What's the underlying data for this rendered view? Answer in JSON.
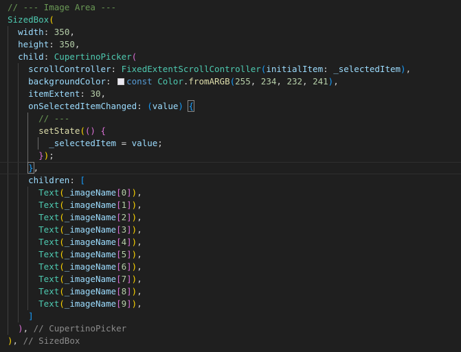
{
  "colors": {
    "background": "#1f1f1f",
    "comment": "#6a9955",
    "class": "#4ec9b0",
    "property": "#9cdcfe",
    "number": "#b5cea8",
    "keyword": "#569cd6",
    "function": "#dcdcaa",
    "bracket_level1": "#ffd700",
    "bracket_level2": "#da70d6",
    "bracket_level3": "#179fff",
    "swatch": "#eae8f1"
  },
  "lines": [
    [
      {
        "t": "// --- Image Area ---",
        "c": "comment"
      }
    ],
    [
      {
        "t": "SizedBox",
        "c": "class"
      },
      {
        "t": "(",
        "c": "p1"
      }
    ],
    [
      {
        "t": "  "
      },
      {
        "t": "width",
        "c": "prop"
      },
      {
        "t": ": "
      },
      {
        "t": "350",
        "c": "num"
      },
      {
        "t": ","
      }
    ],
    [
      {
        "t": "  "
      },
      {
        "t": "height",
        "c": "prop"
      },
      {
        "t": ": "
      },
      {
        "t": "350",
        "c": "num"
      },
      {
        "t": ","
      }
    ],
    [
      {
        "t": "  "
      },
      {
        "t": "child",
        "c": "prop"
      },
      {
        "t": ": "
      },
      {
        "t": "CupertinoPicker",
        "c": "class"
      },
      {
        "t": "(",
        "c": "p2"
      }
    ],
    [
      {
        "t": "    "
      },
      {
        "t": "scrollController",
        "c": "prop"
      },
      {
        "t": ": "
      },
      {
        "t": "FixedExtentScrollController",
        "c": "class"
      },
      {
        "t": "(",
        "c": "p3"
      },
      {
        "t": "initialItem",
        "c": "prop"
      },
      {
        "t": ": "
      },
      {
        "t": "_selectedItem",
        "c": "prop"
      },
      {
        "t": ")",
        "c": "p3"
      },
      {
        "t": ","
      }
    ],
    [
      {
        "t": "    "
      },
      {
        "t": "backgroundColor",
        "c": "prop"
      },
      {
        "t": ": "
      },
      {
        "swatch": true
      },
      {
        "t": "const",
        "c": "kw"
      },
      {
        "t": " "
      },
      {
        "t": "Color",
        "c": "class"
      },
      {
        "t": "."
      },
      {
        "t": "fromARGB",
        "c": "fn"
      },
      {
        "t": "(",
        "c": "p3"
      },
      {
        "t": "255",
        "c": "num"
      },
      {
        "t": ", "
      },
      {
        "t": "234",
        "c": "num"
      },
      {
        "t": ", "
      },
      {
        "t": "232",
        "c": "num"
      },
      {
        "t": ", "
      },
      {
        "t": "241",
        "c": "num"
      },
      {
        "t": ")",
        "c": "p3"
      },
      {
        "t": ","
      }
    ],
    [
      {
        "t": "    "
      },
      {
        "t": "itemExtent",
        "c": "prop"
      },
      {
        "t": ": "
      },
      {
        "t": "30",
        "c": "num"
      },
      {
        "t": ","
      }
    ],
    [
      {
        "t": "    "
      },
      {
        "t": "onSelectedItemChanged",
        "c": "prop"
      },
      {
        "t": ": "
      },
      {
        "t": "(",
        "c": "p3"
      },
      {
        "t": "value",
        "c": "prop"
      },
      {
        "t": ")",
        "c": "p3"
      },
      {
        "t": " "
      },
      {
        "t": "{",
        "c": "p3",
        "box": true
      }
    ],
    [
      {
        "t": "      "
      },
      {
        "t": "// ---",
        "c": "comment"
      }
    ],
    [
      {
        "t": "      "
      },
      {
        "t": "setState",
        "c": "fn"
      },
      {
        "t": "(",
        "c": "p1"
      },
      {
        "t": "()",
        "c": "p2"
      },
      {
        "t": " "
      },
      {
        "t": "{",
        "c": "p2"
      }
    ],
    [
      {
        "t": "        "
      },
      {
        "t": "_selectedItem",
        "c": "prop"
      },
      {
        "t": " = "
      },
      {
        "t": "value",
        "c": "prop"
      },
      {
        "t": ";"
      }
    ],
    [
      {
        "t": "      "
      },
      {
        "t": "}",
        "c": "p2"
      },
      {
        "t": ")",
        "c": "p1"
      },
      {
        "t": ";"
      }
    ],
    [
      {
        "t": "    "
      },
      {
        "t": "}",
        "c": "p3",
        "box": true
      },
      {
        "t": ","
      }
    ],
    [
      {
        "t": "    "
      },
      {
        "t": "children",
        "c": "prop"
      },
      {
        "t": ": "
      },
      {
        "t": "[",
        "c": "p3"
      }
    ],
    [
      {
        "t": "      "
      },
      {
        "t": "Text",
        "c": "class"
      },
      {
        "t": "(",
        "c": "p1"
      },
      {
        "t": "_imageName",
        "c": "prop"
      },
      {
        "t": "[",
        "c": "p2"
      },
      {
        "t": "0",
        "c": "num"
      },
      {
        "t": "]",
        "c": "p2"
      },
      {
        "t": ")",
        "c": "p1"
      },
      {
        "t": ","
      }
    ],
    [
      {
        "t": "      "
      },
      {
        "t": "Text",
        "c": "class"
      },
      {
        "t": "(",
        "c": "p1"
      },
      {
        "t": "_imageName",
        "c": "prop"
      },
      {
        "t": "[",
        "c": "p2"
      },
      {
        "t": "1",
        "c": "num"
      },
      {
        "t": "]",
        "c": "p2"
      },
      {
        "t": ")",
        "c": "p1"
      },
      {
        "t": ","
      }
    ],
    [
      {
        "t": "      "
      },
      {
        "t": "Text",
        "c": "class"
      },
      {
        "t": "(",
        "c": "p1"
      },
      {
        "t": "_imageName",
        "c": "prop"
      },
      {
        "t": "[",
        "c": "p2"
      },
      {
        "t": "2",
        "c": "num"
      },
      {
        "t": "]",
        "c": "p2"
      },
      {
        "t": ")",
        "c": "p1"
      },
      {
        "t": ","
      }
    ],
    [
      {
        "t": "      "
      },
      {
        "t": "Text",
        "c": "class"
      },
      {
        "t": "(",
        "c": "p1"
      },
      {
        "t": "_imageName",
        "c": "prop"
      },
      {
        "t": "[",
        "c": "p2"
      },
      {
        "t": "3",
        "c": "num"
      },
      {
        "t": "]",
        "c": "p2"
      },
      {
        "t": ")",
        "c": "p1"
      },
      {
        "t": ","
      }
    ],
    [
      {
        "t": "      "
      },
      {
        "t": "Text",
        "c": "class"
      },
      {
        "t": "(",
        "c": "p1"
      },
      {
        "t": "_imageName",
        "c": "prop"
      },
      {
        "t": "[",
        "c": "p2"
      },
      {
        "t": "4",
        "c": "num"
      },
      {
        "t": "]",
        "c": "p2"
      },
      {
        "t": ")",
        "c": "p1"
      },
      {
        "t": ","
      }
    ],
    [
      {
        "t": "      "
      },
      {
        "t": "Text",
        "c": "class"
      },
      {
        "t": "(",
        "c": "p1"
      },
      {
        "t": "_imageName",
        "c": "prop"
      },
      {
        "t": "[",
        "c": "p2"
      },
      {
        "t": "5",
        "c": "num"
      },
      {
        "t": "]",
        "c": "p2"
      },
      {
        "t": ")",
        "c": "p1"
      },
      {
        "t": ","
      }
    ],
    [
      {
        "t": "      "
      },
      {
        "t": "Text",
        "c": "class"
      },
      {
        "t": "(",
        "c": "p1"
      },
      {
        "t": "_imageName",
        "c": "prop"
      },
      {
        "t": "[",
        "c": "p2"
      },
      {
        "t": "6",
        "c": "num"
      },
      {
        "t": "]",
        "c": "p2"
      },
      {
        "t": ")",
        "c": "p1"
      },
      {
        "t": ","
      }
    ],
    [
      {
        "t": "      "
      },
      {
        "t": "Text",
        "c": "class"
      },
      {
        "t": "(",
        "c": "p1"
      },
      {
        "t": "_imageName",
        "c": "prop"
      },
      {
        "t": "[",
        "c": "p2"
      },
      {
        "t": "7",
        "c": "num"
      },
      {
        "t": "]",
        "c": "p2"
      },
      {
        "t": ")",
        "c": "p1"
      },
      {
        "t": ","
      }
    ],
    [
      {
        "t": "      "
      },
      {
        "t": "Text",
        "c": "class"
      },
      {
        "t": "(",
        "c": "p1"
      },
      {
        "t": "_imageName",
        "c": "prop"
      },
      {
        "t": "[",
        "c": "p2"
      },
      {
        "t": "8",
        "c": "num"
      },
      {
        "t": "]",
        "c": "p2"
      },
      {
        "t": ")",
        "c": "p1"
      },
      {
        "t": ","
      }
    ],
    [
      {
        "t": "      "
      },
      {
        "t": "Text",
        "c": "class"
      },
      {
        "t": "(",
        "c": "p1"
      },
      {
        "t": "_imageName",
        "c": "prop"
      },
      {
        "t": "[",
        "c": "p2"
      },
      {
        "t": "9",
        "c": "num"
      },
      {
        "t": "]",
        "c": "p2"
      },
      {
        "t": ")",
        "c": "p1"
      },
      {
        "t": ","
      }
    ],
    [
      {
        "t": "    "
      },
      {
        "t": "]",
        "c": "p3"
      }
    ],
    [
      {
        "t": "  "
      },
      {
        "t": ")",
        "c": "p2"
      },
      {
        "t": ", "
      },
      {
        "t": "// CupertinoPicker",
        "c": "hint"
      }
    ],
    [
      {
        "t": ")",
        "c": "p1"
      },
      {
        "t": ", "
      },
      {
        "t": "// SizedBox",
        "c": "hint"
      }
    ]
  ]
}
